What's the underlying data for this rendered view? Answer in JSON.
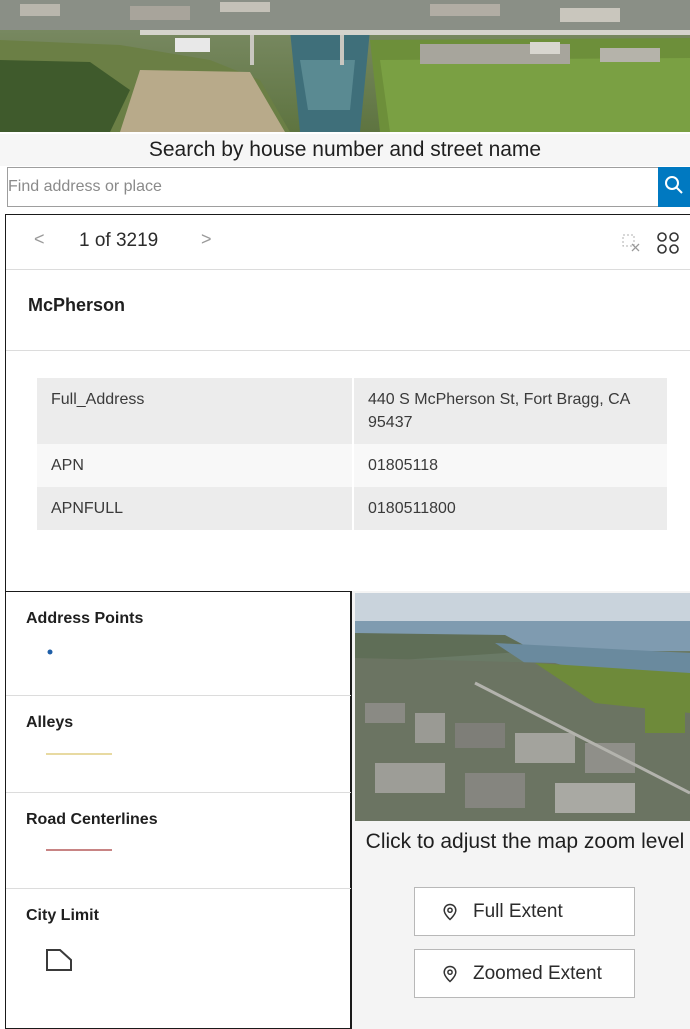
{
  "search": {
    "title": "Search by house number and street name",
    "placeholder": "Find address or place"
  },
  "popup": {
    "pager_prev": "<",
    "pager_count": "1 of 3219",
    "pager_next": ">",
    "feature_title": "McPherson",
    "attributes": [
      {
        "key": "Full_Address",
        "value": "440 S McPherson St, Fort Bragg, CA 95437"
      },
      {
        "key": "APN",
        "value": "01805118"
      },
      {
        "key": "APNFULL",
        "value": "0180511800"
      }
    ]
  },
  "legend": {
    "items": [
      {
        "label": "Address Points",
        "symbol": "point",
        "color": "#1f5fa8"
      },
      {
        "label": "Alleys",
        "symbol": "line",
        "color": "#d9c36a"
      },
      {
        "label": "Road Centerlines",
        "symbol": "line",
        "color": "#a83a3a"
      },
      {
        "label": "City Limit",
        "symbol": "polygon",
        "color": "#3a3a3a"
      }
    ]
  },
  "zoom": {
    "caption": "Click to adjust the map zoom level",
    "full_extent_label": "Full Extent",
    "zoomed_extent_label": "Zoomed Extent"
  },
  "colors": {
    "accent": "#0079c1"
  }
}
